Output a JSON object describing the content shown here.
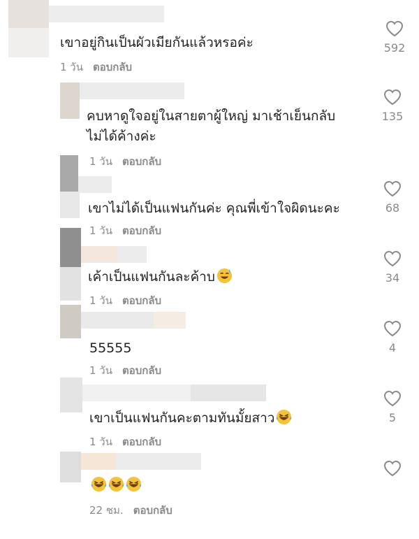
{
  "comments": [
    {
      "text": "เขาอยู่กินเป็นผัวเมียกันแล้วหรอค่ะ",
      "text2": "",
      "time": "1 วัน",
      "reply": "ตอบกลับ",
      "likes": "592",
      "emoji": ""
    },
    {
      "text": "คบหาดูใจอยู่ในสายตาผู้ใหญ่ มาเช้าเย็นกลับ",
      "text2": "ไม่ได้ค้างค่ะ",
      "time": "1 วัน",
      "reply": "ตอบกลับ",
      "likes": "135",
      "emoji": ""
    },
    {
      "text": "เขาไม่ได้เป็นแฟนกันค่ะ คุณพี่เข้าใจผิดนะคะ",
      "text2": "",
      "time": "1 วัน",
      "reply": "ตอบกลับ",
      "likes": "68",
      "emoji": ""
    },
    {
      "text": "เค้าเป็นแฟนกันละค้าบ",
      "text2": "",
      "time": "1 วัน",
      "reply": "ตอบกลับ",
      "likes": "34",
      "emoji": "sweat-smile-emoji"
    },
    {
      "text": "55555",
      "text2": "",
      "time": "1 วัน",
      "reply": "ตอบกลับ",
      "likes": "4",
      "emoji": ""
    },
    {
      "text": "เขาเป็นแฟนกันคะตามทันมั้ยสาว",
      "text2": "",
      "time": "1 วัน",
      "reply": "ตอบกลับ",
      "likes": "5",
      "emoji": "laughing-tears-emoji"
    },
    {
      "text": "",
      "text2": "",
      "time": "22 ชม.",
      "reply": "ตอบกลับ",
      "likes": "",
      "emoji": "laughing-tears-emoji-x3"
    }
  ],
  "colors": {
    "text": "#222222",
    "meta": "#8a8a8a",
    "heart_stroke": "#8a8a8a",
    "redaction": "#ececec"
  }
}
